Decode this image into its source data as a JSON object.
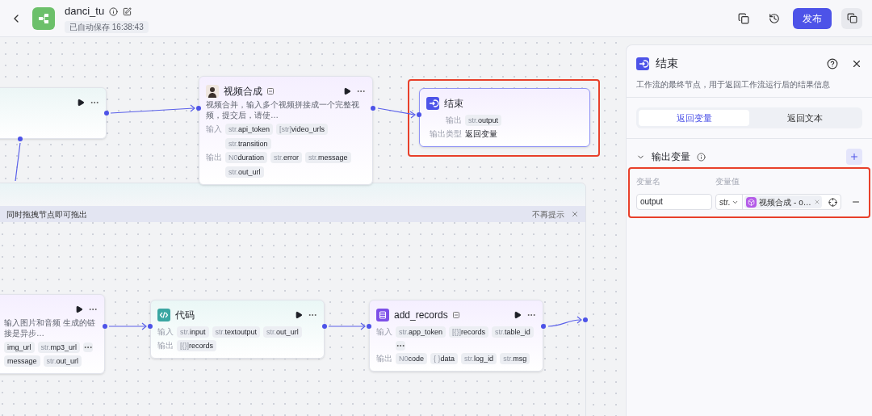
{
  "header": {
    "title": "danci_tu",
    "autosave": "已自动保存 16:38:43",
    "publish_button": "发布"
  },
  "canvas": {
    "nodes": [
      {
        "kind": "stub",
        "highlighted": false
      },
      {
        "kind": "process",
        "title": "视频合成",
        "description": "视频合并，输入多个视频拼接成一个完整视频，提交后，请使…",
        "highlighted": false,
        "rows": [
          {
            "label": "输入",
            "tags": [
              {
                "type": "str.",
                "name": "api_token"
              },
              {
                "type": "[str]",
                "name": "video_urls"
              },
              {
                "type": "str.",
                "name": "transition"
              }
            ],
            "truncated": false
          },
          {
            "label": "输出",
            "tags": [
              {
                "type": "N0",
                "name": "duration"
              },
              {
                "type": "str.",
                "name": "error"
              },
              {
                "type": "str.",
                "name": "message"
              },
              {
                "type": "str.",
                "name": "out_url"
              }
            ],
            "truncated": false
          }
        ]
      },
      {
        "kind": "end",
        "title": "结束",
        "highlighted": true,
        "rows": [
          {
            "label": "输出",
            "tags": [
              {
                "type": "str.",
                "name": "output"
              }
            ],
            "truncated": false
          },
          {
            "label": "输出类型",
            "value": "返回变量"
          }
        ]
      },
      {
        "kind": "process",
        "description": "输入图片和音频 生成的链接是异步…",
        "highlighted": false,
        "rows": [
          {
            "tags": [
              {
                "name": "img_url"
              },
              {
                "type": "str.",
                "name": "mp3_url"
              }
            ],
            "truncated": true
          },
          {
            "tags": [
              {
                "name": "message"
              },
              {
                "type": "str.",
                "name": "out_url"
              }
            ],
            "truncated": false
          }
        ]
      },
      {
        "kind": "process",
        "title": "代码",
        "highlighted": false,
        "rows": [
          {
            "label": "输入",
            "tags": [
              {
                "type": "str.",
                "name": "input"
              },
              {
                "type": "str.",
                "name": "textoutput"
              },
              {
                "type": "str.",
                "name": "out_url"
              }
            ],
            "truncated": false
          },
          {
            "label": "输出",
            "tags": [
              {
                "type": "[{}]",
                "name": "records"
              }
            ],
            "truncated": false
          }
        ]
      },
      {
        "kind": "process",
        "title": "add_records",
        "highlighted": false,
        "rows": [
          {
            "label": "输入",
            "tags": [
              {
                "type": "str.",
                "name": "app_token"
              },
              {
                "type": "[{}]",
                "name": "records"
              },
              {
                "type": "str.",
                "name": "table_id"
              }
            ],
            "truncated": true
          },
          {
            "label": "输出",
            "tags": [
              {
                "type": "N0",
                "name": "code"
              },
              {
                "type": "{ }",
                "name": "data"
              },
              {
                "type": "str.",
                "name": "log_id"
              },
              {
                "type": "str.",
                "name": "msg"
              }
            ],
            "truncated": false
          }
        ]
      }
    ],
    "group_hint": {
      "text": "同时拖拽节点即可拖出",
      "dismiss": "不再提示"
    }
  },
  "panel": {
    "title": "结束",
    "description": "工作流的最终节点，用于返回工作流运行后的结果信息",
    "tabs": [
      {
        "label": "返回变量",
        "selected": true
      },
      {
        "label": "返回文本",
        "selected": false
      }
    ],
    "section": {
      "title": "输出变量",
      "expanded": true,
      "highlighted": true,
      "columns": [
        "变量名",
        "变量值"
      ],
      "rows": [
        {
          "name": "output",
          "type": "str.",
          "reference": "视频合成 - o…"
        }
      ]
    }
  }
}
